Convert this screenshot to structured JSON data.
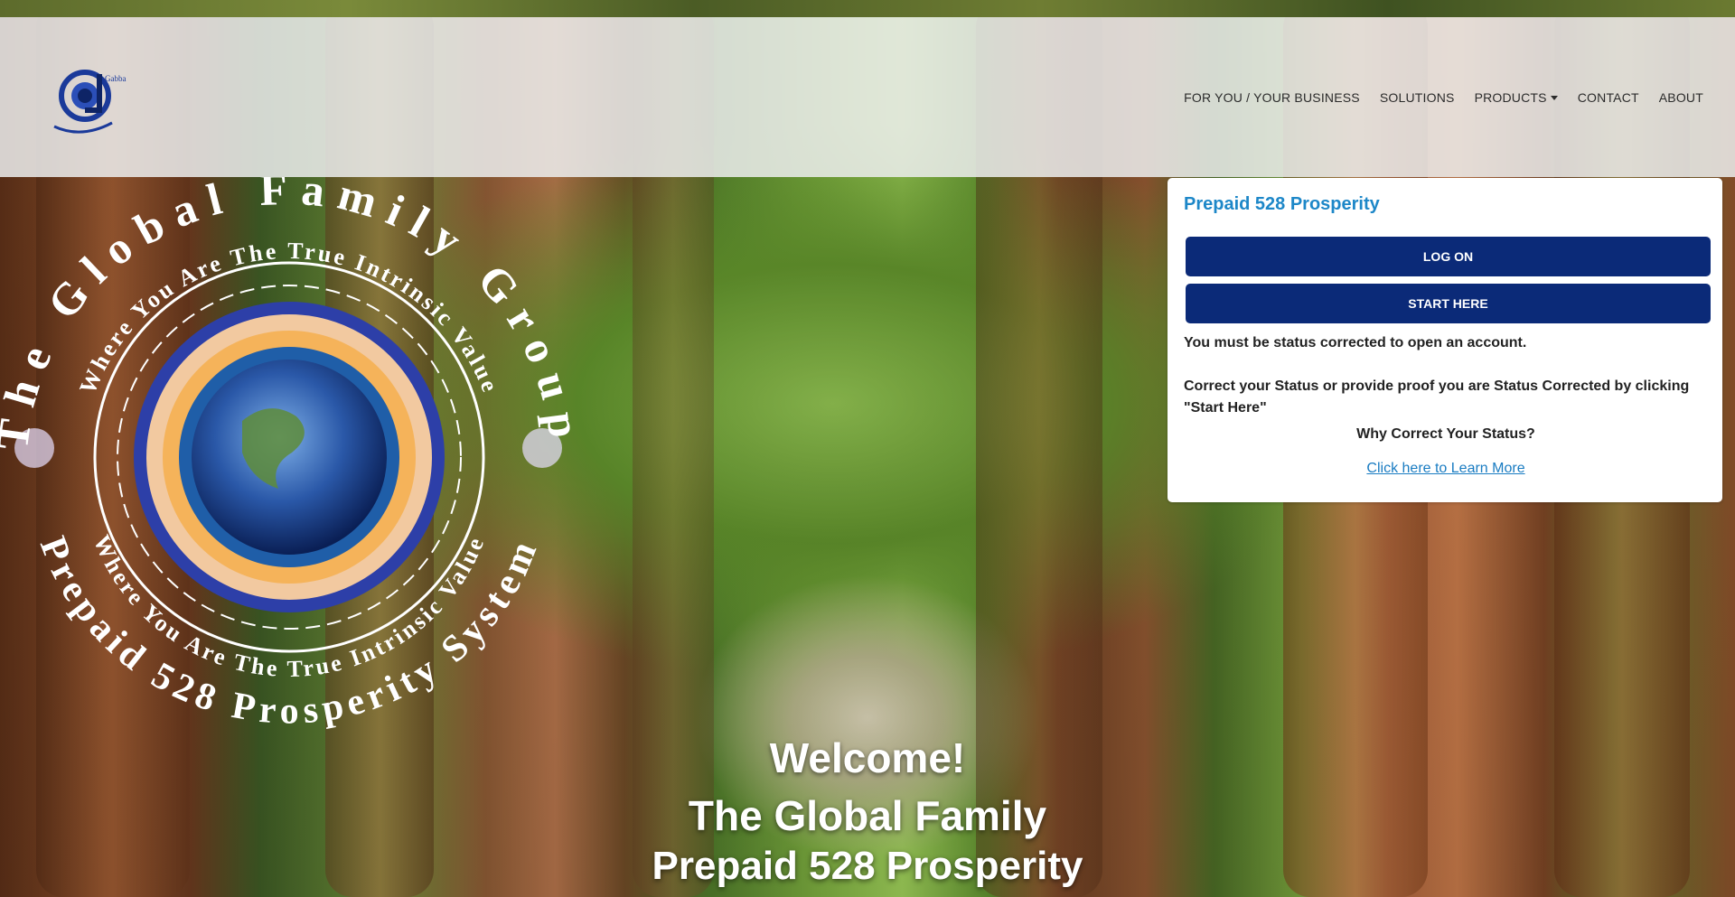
{
  "brand": {
    "logo_text": "Gabba"
  },
  "nav": {
    "items": [
      {
        "label": "FOR YOU / YOUR BUSINESS",
        "dropdown": false
      },
      {
        "label": "SOLUTIONS",
        "dropdown": false
      },
      {
        "label": "PRODUCTS",
        "dropdown": true
      },
      {
        "label": "CONTACT",
        "dropdown": false
      },
      {
        "label": "ABOUT",
        "dropdown": false
      }
    ]
  },
  "emblem": {
    "outer_text": "The Global Family Group",
    "inner_text": "Where You Are The True Intrinsic Value",
    "bottom_outer_text": "Prepaid 528 Prosperity System",
    "bottom_inner_text": "Where You Are The True Intrinsic Value"
  },
  "card": {
    "title": "Prepaid 528 Prosperity",
    "logon_label": "LOG ON",
    "start_label": "START HERE",
    "message1": "You must be status corrected to open an account.",
    "message2": "Correct your Status or provide proof you are Status Corrected by clicking \"Start Here\"",
    "why": "Why Correct Your Status?",
    "learn_more": "Click here to Learn More"
  },
  "hero": {
    "line1": "Welcome!",
    "line2": "The Global Family",
    "line3": "Prepaid 528 Prosperity"
  },
  "colors": {
    "accent": "#1d87c8",
    "button": "#0b2a78",
    "link": "#1a7cc2"
  }
}
